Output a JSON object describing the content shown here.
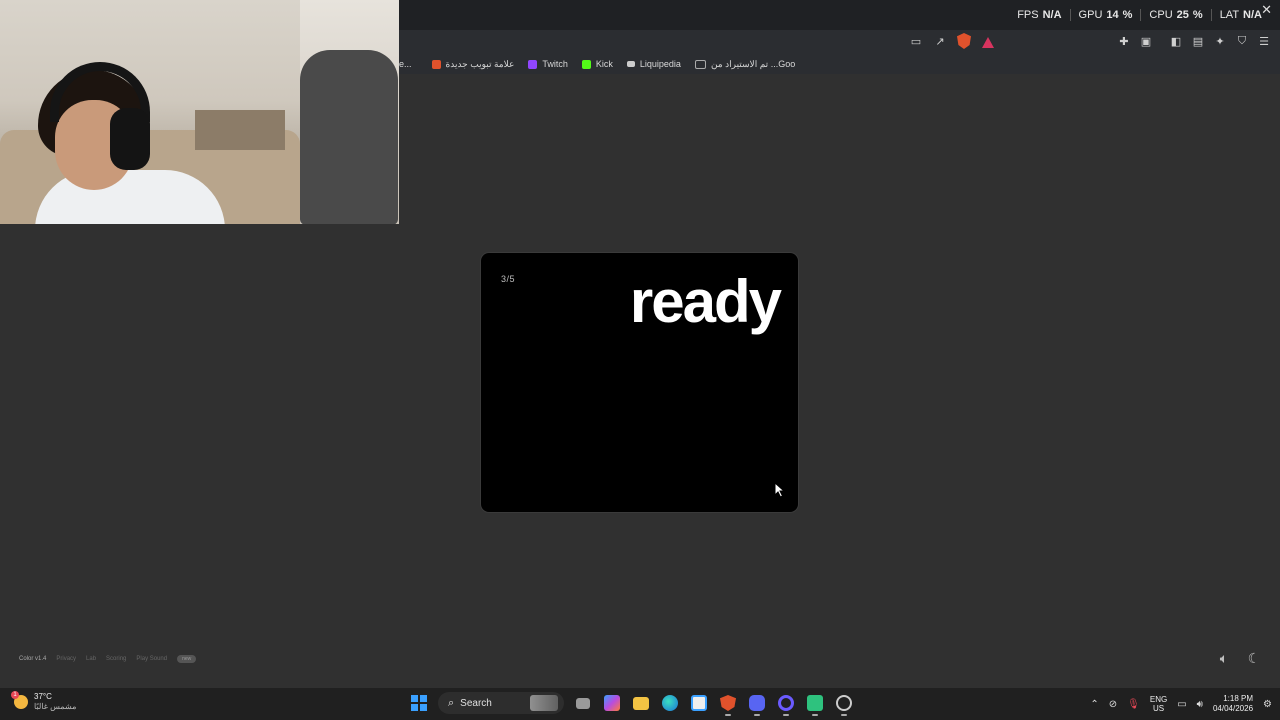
{
  "overlay": {
    "fps_label": "FPS",
    "fps_value": "N/A",
    "gpu_label": "GPU",
    "gpu_value": "14",
    "cpu_label": "CPU",
    "cpu_value": "25",
    "lat_label": "LAT",
    "lat_value": "N/A",
    "percent": "%"
  },
  "bookmarks": [
    {
      "label": "علامة تبويب جديدة",
      "color": "#e0522c"
    },
    {
      "label": "Twitch",
      "color": "#9146ff"
    },
    {
      "label": "Kick",
      "color": "#53fc18"
    },
    {
      "label": "Liquipedia",
      "color": "#cccccc"
    },
    {
      "label": "تم الاستيراد من ...Goo",
      "color": "#888888"
    }
  ],
  "bookmark_leading": "e...",
  "card": {
    "counter": "3/5",
    "word": "ready"
  },
  "footer": {
    "brand": "Color v1.4",
    "links": [
      "Privacy",
      "Lab",
      "Scoring",
      "Play Sound"
    ],
    "pill": "new"
  },
  "taskbar": {
    "temperature": "37°C",
    "weather_desc": "مشمس غالبًا",
    "weather_badge": "1",
    "search_label": "Search",
    "lang_top": "ENG",
    "lang_bottom": "US",
    "time": "1:18 PM",
    "date": "04/04/2026"
  },
  "colors": {
    "accent": "#3aa0ff",
    "brave": "#e0522c",
    "twitch": "#9146ff",
    "kick": "#53fc18"
  }
}
